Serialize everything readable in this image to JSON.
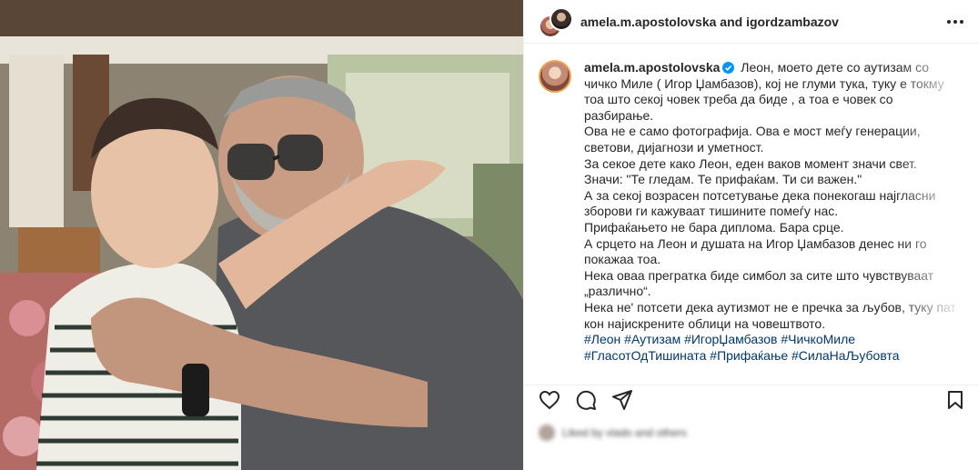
{
  "header": {
    "title": "amela.m.apostolovska and igordzambazov",
    "more_icon": "more-horizontal-icon"
  },
  "caption": {
    "username": "amela.m.apostolovska",
    "verified_icon": "verified-badge-icon",
    "lines": [
      "Леон, моето дете со аутизам со",
      "чичко Миле ( Игор Џамбазов), кој не глуми тука, туку е токму",
      "тоа што секој човек треба да биде , а тоа е човек со",
      "разбирање.",
      "Ова не е само фотографија. Ова е мост меѓу генерации,",
      "светови, дијагнози и уметност.",
      "За секое дете како Леон, еден ваков момент значи свет.",
      "Значи: \"Те гледам. Те прифаќам. Ти си важен.\"",
      "А за секој возрасен потсетување дека понекогаш најгласни",
      "зборови ги кажуваат тишините помеѓу нас.",
      "Прифаќањето не бара диплома. Бара срце.",
      "А срцето на Леон и душата на Игор Џамбазов денес ни го",
      "покажаа тоа.",
      "Нека оваа прегратка биде симбол за сите што чувствуваат",
      "„различно“.",
      "Нека не' потсети дека аутизмот не е пречка за љубов, туку пат",
      "кон најискрените облици на човештвото."
    ],
    "hashtags_line1": "#Леон #Аутизам #ИгорЏамбазов #ЧичкоМиле",
    "hashtags_line2": "#ГласотОдТишината #Прифаќање #СилаНаЉубовта"
  },
  "actions": {
    "like_icon": "heart-icon",
    "comment_icon": "comment-icon",
    "share_icon": "share-icon",
    "save_icon": "bookmark-icon"
  },
  "likes": {
    "text": "Liked by vlado and others"
  },
  "colors": {
    "text": "#262626",
    "hashtag": "#00376b",
    "verified": "#0095f6",
    "border": "#efefef"
  }
}
